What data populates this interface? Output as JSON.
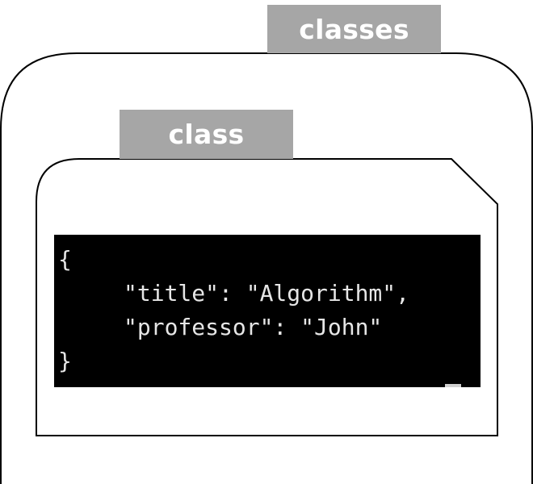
{
  "outer_container": {
    "tab_label": "classes"
  },
  "inner_container": {
    "tab_label": "class"
  },
  "terminal": {
    "lines": [
      "{",
      "\"title\": \"Algorithm\",",
      "\"professor\": \"John\"",
      "}"
    ]
  },
  "colors": {
    "tab": "#a6a6a6",
    "tab_text": "#ffffff",
    "terminal_bg": "#000000",
    "terminal_text": "#e6e6e6",
    "stroke": "#000000"
  }
}
